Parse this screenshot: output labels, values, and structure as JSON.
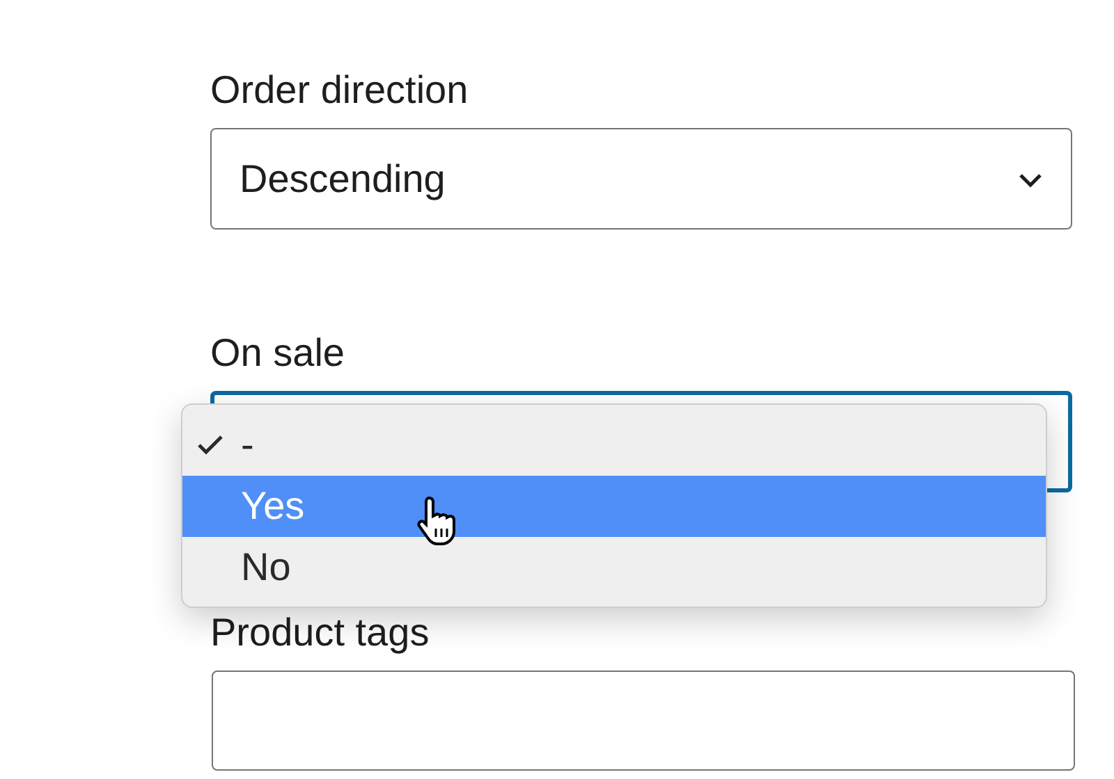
{
  "fields": [
    {
      "kind": "select",
      "label": "Order direction",
      "value": "Descending",
      "focused": false
    },
    {
      "kind": "select",
      "label": "On sale",
      "focused": true,
      "menu": [
        {
          "label": "-",
          "checked": true,
          "selected": false
        },
        {
          "label": "Yes",
          "checked": false,
          "selected": true
        },
        {
          "label": "No",
          "checked": false,
          "selected": false
        }
      ]
    },
    {
      "kind": "text",
      "label": "Product tags",
      "focused": false
    }
  ]
}
